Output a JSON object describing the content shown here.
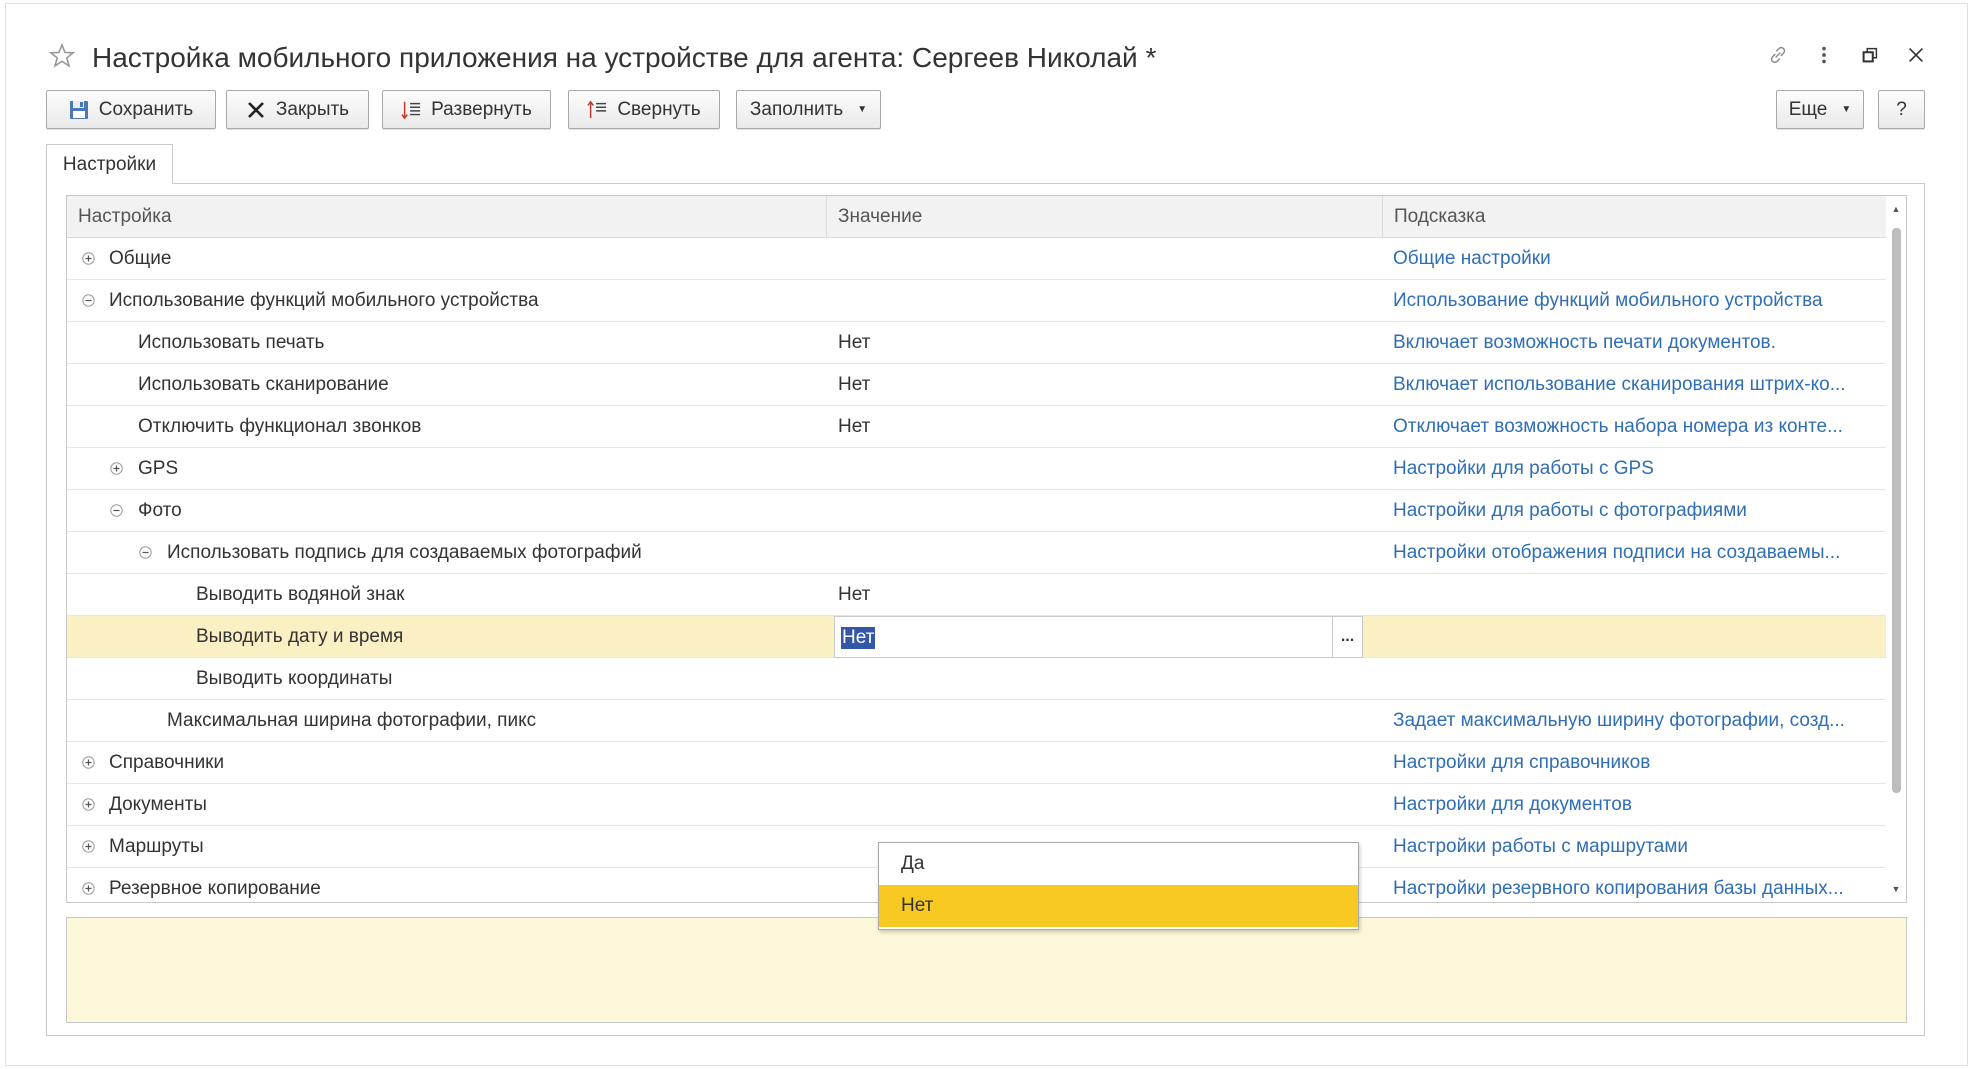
{
  "window": {
    "title": "Настройка мобильного приложения на устройстве для агента: Сергеев Николай *",
    "actions": [
      "link-icon",
      "more-vertical-icon",
      "restore-icon",
      "close-icon"
    ]
  },
  "toolbar": {
    "save_label": "Сохранить",
    "close_label": "Закрыть",
    "expand_label": "Развернуть",
    "collapse_label": "Свернуть",
    "fill_label": "Заполнить",
    "more_label": "Еще",
    "help_label": "?"
  },
  "tabs": [
    {
      "label": "Настройки"
    }
  ],
  "grid": {
    "columns": [
      "Настройка",
      "Значение",
      "Подсказка"
    ],
    "rows": [
      {
        "name": "Общие",
        "value": "",
        "hint": "Общие настройки",
        "toggle": "plus"
      },
      {
        "name": "Использование функций мобильного устройства",
        "value": "",
        "hint": "Использование функций мобильного устройства",
        "toggle": "minus"
      },
      {
        "name": "Использовать печать",
        "value": "Нет",
        "hint": "Включает возможность печати документов.",
        "toggle": ""
      },
      {
        "name": "Использовать сканирование",
        "value": "Нет",
        "hint": "Включает использование сканирования штрих-ко...",
        "toggle": ""
      },
      {
        "name": "Отключить функционал звонков",
        "value": "Нет",
        "hint": "Отключает возможность набора номера из конте...",
        "toggle": ""
      },
      {
        "name": "GPS",
        "value": "",
        "hint": "Настройки для работы с GPS",
        "toggle": "plus"
      },
      {
        "name": "Фото",
        "value": "",
        "hint": "Настройки для работы с фотографиями",
        "toggle": "minus"
      },
      {
        "name": "Использовать подпись для создаваемых фотографий",
        "value": "",
        "hint": "Настройки отображения подписи на создаваемы...",
        "toggle": "minus"
      },
      {
        "name": "Выводить водяной знак",
        "value": "Нет",
        "hint": "",
        "toggle": ""
      },
      {
        "name": "Выводить дату и время",
        "value": "Нет",
        "hint": "",
        "toggle": ""
      },
      {
        "name": "Выводить координаты",
        "value": "",
        "hint": "",
        "toggle": ""
      },
      {
        "name": "Максимальная ширина фотографии, пикс",
        "value": "",
        "hint": "Задает максимальную ширину фотографии, созд...",
        "toggle": ""
      },
      {
        "name": "Справочники",
        "value": "",
        "hint": "Настройки для справочников",
        "toggle": "plus"
      },
      {
        "name": "Документы",
        "value": "",
        "hint": "Настройки для документов",
        "toggle": "plus"
      },
      {
        "name": "Маршруты",
        "value": "",
        "hint": "Настройки работы с маршрутами",
        "toggle": "plus"
      },
      {
        "name": "Резервное копирование",
        "value": "",
        "hint": "Настройки резервного копирования базы данных...",
        "toggle": "plus"
      }
    ]
  },
  "editor": {
    "current_value": "Нет",
    "choice_button": "..."
  },
  "dropdown": {
    "options": [
      "Да",
      "Нет"
    ],
    "selected": "Нет"
  },
  "colors": {
    "link": "#2f6eb5",
    "selected_row": "#fbf0c4",
    "dropdown_active": "#f8c922",
    "info_panel": "#fdf7d9"
  }
}
